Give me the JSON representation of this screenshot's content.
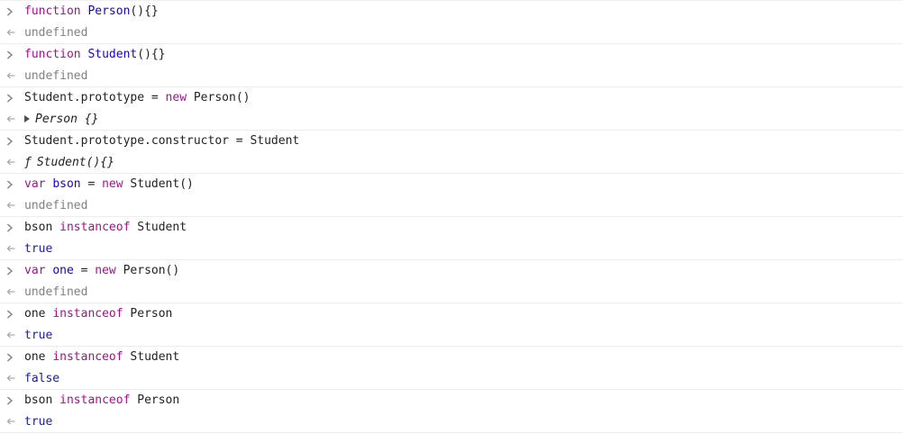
{
  "entries": [
    {
      "input": [
        {
          "t": "function",
          "c": "kw"
        },
        {
          "t": " ",
          "c": "plain"
        },
        {
          "t": "Person",
          "c": "fn"
        },
        {
          "t": "(){}",
          "c": "plain"
        }
      ],
      "output": {
        "type": "undef",
        "text": "undefined"
      }
    },
    {
      "input": [
        {
          "t": "function",
          "c": "kw"
        },
        {
          "t": " ",
          "c": "plain"
        },
        {
          "t": "Student",
          "c": "fn"
        },
        {
          "t": "(){}",
          "c": "plain"
        }
      ],
      "output": {
        "type": "undef",
        "text": "undefined"
      }
    },
    {
      "input": [
        {
          "t": "Student.prototype = ",
          "c": "plain"
        },
        {
          "t": "new",
          "c": "kw"
        },
        {
          "t": " Person()",
          "c": "plain"
        }
      ],
      "output": {
        "type": "object",
        "text": "Person {}"
      }
    },
    {
      "input": [
        {
          "t": "Student.prototype.constructor = Student",
          "c": "plain"
        }
      ],
      "output": {
        "type": "func",
        "glyph": "ƒ",
        "text": "Student(){}"
      }
    },
    {
      "input": [
        {
          "t": "var",
          "c": "kw"
        },
        {
          "t": " ",
          "c": "plain"
        },
        {
          "t": "bson",
          "c": "fn"
        },
        {
          "t": " = ",
          "c": "plain"
        },
        {
          "t": "new",
          "c": "kw"
        },
        {
          "t": " Student()",
          "c": "plain"
        }
      ],
      "output": {
        "type": "undef",
        "text": "undefined"
      }
    },
    {
      "input": [
        {
          "t": "bson ",
          "c": "plain"
        },
        {
          "t": "instanceof",
          "c": "kw"
        },
        {
          "t": " Student",
          "c": "plain"
        }
      ],
      "output": {
        "type": "bool",
        "text": "true"
      }
    },
    {
      "input": [
        {
          "t": "var",
          "c": "kw"
        },
        {
          "t": " ",
          "c": "plain"
        },
        {
          "t": "one",
          "c": "fn"
        },
        {
          "t": " = ",
          "c": "plain"
        },
        {
          "t": "new",
          "c": "kw"
        },
        {
          "t": " Person()",
          "c": "plain"
        }
      ],
      "output": {
        "type": "undef",
        "text": "undefined"
      }
    },
    {
      "input": [
        {
          "t": "one ",
          "c": "plain"
        },
        {
          "t": "instanceof",
          "c": "kw"
        },
        {
          "t": " Person",
          "c": "plain"
        }
      ],
      "output": {
        "type": "bool",
        "text": "true"
      }
    },
    {
      "input": [
        {
          "t": "one ",
          "c": "plain"
        },
        {
          "t": "instanceof",
          "c": "kw"
        },
        {
          "t": " Student",
          "c": "plain"
        }
      ],
      "output": {
        "type": "bool",
        "text": "false"
      }
    },
    {
      "input": [
        {
          "t": "bson ",
          "c": "plain"
        },
        {
          "t": "instanceof",
          "c": "kw"
        },
        {
          "t": " Person",
          "c": "plain"
        }
      ],
      "output": {
        "type": "bool",
        "text": "true"
      }
    }
  ],
  "icons": {
    "input_prompt": "chevron-right-icon",
    "output_prompt": "return-arrow-icon",
    "expand": "expand-triangle-icon"
  },
  "colors": {
    "keyword": "#aa0d91",
    "identifier": "#1c00cf",
    "text": "#222222",
    "undefined": "#808080",
    "boolean": "#1a1aa6",
    "prompt": "#8a8a8a"
  }
}
